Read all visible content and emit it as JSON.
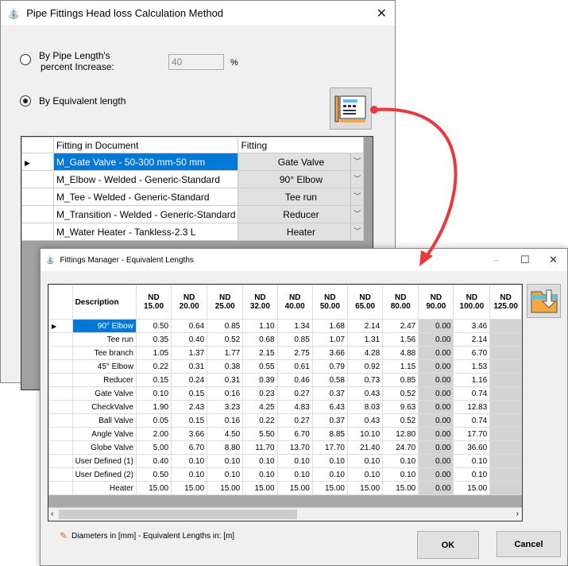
{
  "main_window": {
    "title": "Pipe Fittings Head loss Calculation Method",
    "close": "✕",
    "option_percent_line1": "By Pipe Length's",
    "option_percent_line2": "percent Increase:",
    "percent_value": "40",
    "percent_unit": "%",
    "option_equivalent": "By Equivalent length",
    "grid": {
      "headers": [
        "Fitting in Document",
        "Fitting"
      ],
      "rows": [
        {
          "doc": "M_Gate Valve - 50-300 mm-50 mm",
          "fitting": "Gate Valve"
        },
        {
          "doc": "M_Elbow - Welded - Generic-Standard",
          "fitting": "90° Elbow"
        },
        {
          "doc": "M_Tee - Welded - Generic-Standard",
          "fitting": "Tee run"
        },
        {
          "doc": "M_Transition - Welded - Generic-Standard",
          "fitting": "Reducer"
        },
        {
          "doc": "M_Water Heater - Tankless-2.3 L",
          "fitting": "Heater"
        }
      ]
    }
  },
  "fittings_window": {
    "title": "Fittings Manager - Equivalent Lengths",
    "minimize": "–",
    "maximize": "☐",
    "close": "✕",
    "columns": [
      "Description",
      "ND\n15.00",
      "ND\n20.00",
      "ND\n25.00",
      "ND\n32.00",
      "ND\n40.00",
      "ND\n50.00",
      "ND\n65.00",
      "ND\n80.00",
      "ND\n90.00",
      "ND\n100.00",
      "ND\n125.00"
    ],
    "rows": [
      [
        "90° Elbow",
        "0.50",
        "0.64",
        "0.85",
        "1.10",
        "1.34",
        "1.68",
        "2.14",
        "2.47",
        "0.00",
        "3.46"
      ],
      [
        "Tee run",
        "0.35",
        "0.40",
        "0.52",
        "0.68",
        "0.85",
        "1.07",
        "1.31",
        "1.56",
        "0.00",
        "2.14"
      ],
      [
        "Tee branch",
        "1.05",
        "1.37",
        "1.77",
        "2.15",
        "2.75",
        "3.66",
        "4.28",
        "4.88",
        "0.00",
        "6.70"
      ],
      [
        "45° Elbow",
        "0.22",
        "0.31",
        "0.38",
        "0.55",
        "0.61",
        "0.79",
        "0.92",
        "1.15",
        "0.00",
        "1.53"
      ],
      [
        "Reducer",
        "0.15",
        "0.24",
        "0.31",
        "0.39",
        "0.46",
        "0.58",
        "0.73",
        "0.85",
        "0.00",
        "1.16"
      ],
      [
        "Gate Valve",
        "0.10",
        "0.15",
        "0.16",
        "0.23",
        "0.27",
        "0.37",
        "0.43",
        "0.52",
        "0.00",
        "0.74"
      ],
      [
        "CheckValve",
        "1.90",
        "2.43",
        "3.23",
        "4.25",
        "4.83",
        "6.43",
        "8.03",
        "9.63",
        "0.00",
        "12.83"
      ],
      [
        "Ball Valve",
        "0.05",
        "0.15",
        "0.16",
        "0.22",
        "0.27",
        "0.37",
        "0.43",
        "0.52",
        "0.00",
        "0.74"
      ],
      [
        "Angle Valve",
        "2.00",
        "3.66",
        "4.50",
        "5.50",
        "6.70",
        "8.85",
        "10.10",
        "12.80",
        "0.00",
        "17.70"
      ],
      [
        "Globe Valve",
        "5.00",
        "6.70",
        "8.80",
        "11.70",
        "13.70",
        "17.70",
        "21.40",
        "24.70",
        "0.00",
        "36.60"
      ],
      [
        "User Defined (1)",
        "0.40",
        "0.10",
        "0.10",
        "0.10",
        "0.10",
        "0.10",
        "0.10",
        "0.10",
        "0.00",
        "0.10"
      ],
      [
        "User Defined (2)",
        "0.50",
        "0.10",
        "0.10",
        "0.10",
        "0.10",
        "0.10",
        "0.10",
        "0.10",
        "0.00",
        "0.10"
      ],
      [
        "Heater",
        "15.00",
        "15.00",
        "15.00",
        "15.00",
        "15.00",
        "15.00",
        "15.00",
        "15.00",
        "0.00",
        "15.00"
      ]
    ],
    "units_note": "Diameters in [mm] - Equivalent Lengths in: [m]",
    "ok": "OK",
    "cancel": "Cancel"
  },
  "colors": {
    "selection": "#0078d7",
    "arrow": "#e8393f",
    "folder": "#f5a742"
  }
}
